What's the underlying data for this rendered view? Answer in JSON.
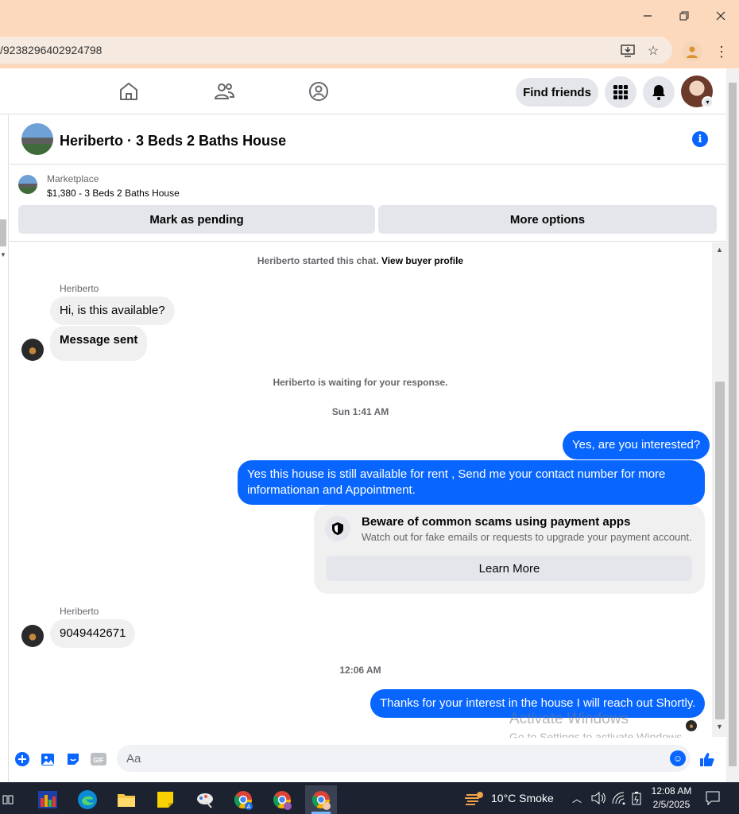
{
  "browser": {
    "url": "/9238296402924798",
    "window_controls": {
      "minimize": "minimize-icon",
      "restore": "restore-icon",
      "close": "close-icon"
    }
  },
  "fb_header": {
    "find_friends": "Find friends"
  },
  "chat": {
    "title": "Heriberto · 3 Beds 2 Baths House",
    "listing": {
      "category": "Marketplace",
      "price_title": "$1,380 - 3 Beds 2 Baths House",
      "mark_pending": "Mark as pending",
      "more_options": "More options"
    },
    "started_prefix": "Heriberto started this chat.",
    "view_profile": "View buyer profile",
    "messages": [
      {
        "sender": "Heriberto",
        "text": "Hi, is this available?"
      },
      {
        "text": "Message sent"
      }
    ],
    "waiting": "Heriberto is waiting for your response.",
    "time1": "Sun 1:41 AM",
    "outgoing1": "Yes, are you interested?",
    "outgoing2": "Yes this house is still available for rent , Send me your contact number for more informationan and Appointment.",
    "scam_card": {
      "title": "Beware of common scams using payment apps",
      "subtitle": "Watch out for fake emails or requests to upgrade your payment account.",
      "button": "Learn More"
    },
    "sender2": "Heriberto",
    "incoming_number": "9049442671",
    "time2": "12:06 AM",
    "outgoing3": "Thanks for your interest in the house I will reach out Shortly.",
    "composer_placeholder": "Aa"
  },
  "watermark": {
    "line1": "Activate Windows",
    "line2": "Go to Settings to activate Windows."
  },
  "taskbar": {
    "weather": "10°C  Smoke",
    "time": "12:08 AM",
    "date": "2/5/2025"
  },
  "colors": {
    "messenger_blue": "#0866ff",
    "title_bar": "#fcd9bd",
    "bubble_gray": "#f0f0f0"
  }
}
